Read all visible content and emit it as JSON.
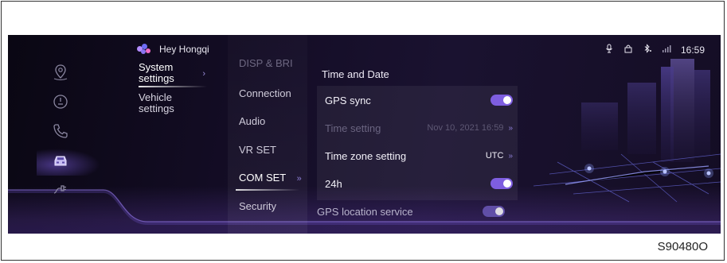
{
  "voice_assistant": {
    "label": "Hey Hongqi",
    "colors": [
      "#b38cff",
      "#6f6cf5",
      "#f06cc8"
    ]
  },
  "status_bar": {
    "icons": [
      "microphone-icon",
      "lock-icon",
      "bluetooth-icon",
      "signal-icon"
    ],
    "bluetooth_text": "*⁎",
    "signal_text": "⁞ıll",
    "time": "16:59"
  },
  "rail": {
    "items": [
      {
        "icon": "navigation-icon",
        "active": false
      },
      {
        "icon": "dashboard-icon",
        "active": false
      },
      {
        "icon": "phone-icon",
        "active": false
      },
      {
        "icon": "car-icon",
        "active": true
      },
      {
        "icon": "charging-icon",
        "active": false
      }
    ]
  },
  "menu1": {
    "items": [
      {
        "label": "System settings",
        "active": true,
        "chevron": "›"
      },
      {
        "label": "Vehicle settings",
        "active": false
      }
    ]
  },
  "menu2": {
    "items": [
      {
        "label": "DISP & BRI",
        "state": "faded"
      },
      {
        "label": "Connection",
        "state": "normal"
      },
      {
        "label": "Audio",
        "state": "normal"
      },
      {
        "label": "VR SET",
        "state": "normal"
      },
      {
        "label": "COM SET",
        "state": "active",
        "chevron": "»"
      },
      {
        "label": "Security",
        "state": "normal"
      }
    ]
  },
  "content": {
    "section_title": "Time and Date",
    "rows": [
      {
        "label": "GPS sync",
        "type": "toggle",
        "on": true,
        "enabled": true
      },
      {
        "label": "Time setting",
        "type": "value",
        "value": "Nov 10, 2021 16:59",
        "chevron": "»",
        "enabled": false
      },
      {
        "label": "Time zone setting",
        "type": "value",
        "value": "UTC",
        "chevron": "»",
        "enabled": true
      },
      {
        "label": "24h",
        "type": "toggle",
        "on": true,
        "enabled": true
      },
      {
        "label": "GPS location service",
        "type": "toggle",
        "on": true,
        "enabled": true
      }
    ]
  },
  "caption": "S90480O",
  "colors": {
    "accent": "#7e5ee0",
    "background": "#140d26"
  }
}
